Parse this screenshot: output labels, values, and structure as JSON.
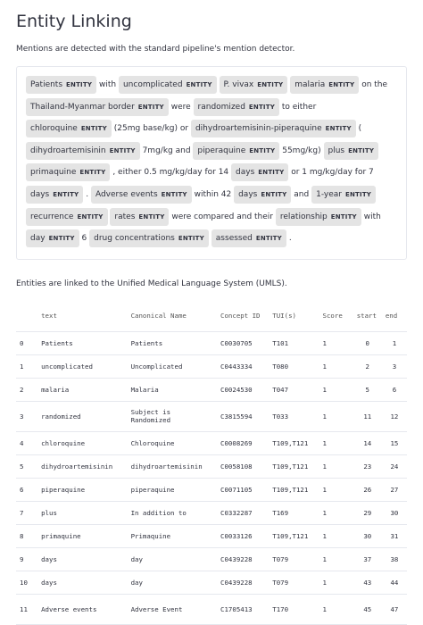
{
  "page": {
    "title": "Entity Linking",
    "ner_caption": "Mentions are detected with the standard pipeline's mention detector.",
    "table_caption": "Entities are linked to the Unified Medical Language System (UMLS)."
  },
  "ner": {
    "label": "ENTITY",
    "tokens": [
      {
        "t": "Patients",
        "e": true
      },
      {
        "t": "with",
        "e": false
      },
      {
        "t": "uncomplicated",
        "e": true
      },
      {
        "t": "P. vivax",
        "e": true
      },
      {
        "t": "malaria",
        "e": true
      },
      {
        "t": "on the",
        "e": false
      },
      {
        "t": "Thailand-Myanmar border",
        "e": true
      },
      {
        "t": "were",
        "e": false
      },
      {
        "t": "randomized",
        "e": true
      },
      {
        "t": "to either",
        "e": false
      },
      {
        "t": "chloroquine",
        "e": true
      },
      {
        "t": "(25mg base/kg) or",
        "e": false
      },
      {
        "t": "dihydroartemisinin-piperaquine",
        "e": true
      },
      {
        "t": "(",
        "e": false
      },
      {
        "t": "dihydroartemisinin",
        "e": true
      },
      {
        "t": "7mg/kg and",
        "e": false
      },
      {
        "t": "piperaquine",
        "e": true
      },
      {
        "t": "55mg/kg)",
        "e": false
      },
      {
        "t": "plus",
        "e": true
      },
      {
        "t": "primaquine",
        "e": true
      },
      {
        "t": ", either 0.5 mg/kg/day for 14",
        "e": false
      },
      {
        "t": "days",
        "e": true
      },
      {
        "t": "or 1 mg/kg/day for 7",
        "e": false
      },
      {
        "t": "days",
        "e": true
      },
      {
        "t": ".",
        "e": false
      },
      {
        "t": "Adverse events",
        "e": true
      },
      {
        "t": "within 42",
        "e": false
      },
      {
        "t": "days",
        "e": true
      },
      {
        "t": "and",
        "e": false
      },
      {
        "t": "1-year",
        "e": true
      },
      {
        "t": "recurrence",
        "e": true
      },
      {
        "t": "rates",
        "e": true
      },
      {
        "t": "were compared and their",
        "e": false
      },
      {
        "t": "relationship",
        "e": true
      },
      {
        "t": "with",
        "e": false
      },
      {
        "t": "day",
        "e": true
      },
      {
        "t": "6",
        "e": false
      },
      {
        "t": "drug concentrations",
        "e": true
      },
      {
        "t": "assessed",
        "e": true
      },
      {
        "t": ".",
        "e": false
      }
    ]
  },
  "table": {
    "headers": [
      "",
      "text",
      "Canonical Name",
      "Concept ID",
      "TUI(s)",
      "Score",
      "start",
      "end"
    ],
    "rows": [
      [
        "0",
        "Patients",
        "Patients",
        "C0030705",
        "T101",
        "1",
        "0",
        "1"
      ],
      [
        "1",
        "uncomplicated",
        "Uncomplicated",
        "C0443334",
        "T080",
        "1",
        "2",
        "3"
      ],
      [
        "2",
        "malaria",
        "Malaria",
        "C0024530",
        "T047",
        "1",
        "5",
        "6"
      ],
      [
        "3",
        "randomized",
        "Subject is Randomized",
        "C3815594",
        "T033",
        "1",
        "11",
        "12"
      ],
      [
        "4",
        "chloroquine",
        "Chloroquine",
        "C0008269",
        "T109,T121",
        "1",
        "14",
        "15"
      ],
      [
        "5",
        "dihydroartemisinin",
        "dihydroartemisinin",
        "C0058108",
        "T109,T121",
        "1",
        "23",
        "24"
      ],
      [
        "6",
        "piperaquine",
        "piperaquine",
        "C0071105",
        "T109,T121",
        "1",
        "26",
        "27"
      ],
      [
        "7",
        "plus",
        "In addition to",
        "C0332287",
        "T169",
        "1",
        "29",
        "30"
      ],
      [
        "8",
        "primaquine",
        "Primaquine",
        "C0033126",
        "T109,T121",
        "1",
        "30",
        "31"
      ],
      [
        "9",
        "days",
        "day",
        "C0439228",
        "T079",
        "1",
        "37",
        "38"
      ],
      [
        "10",
        "days",
        "day",
        "C0439228",
        "T079",
        "1",
        "43",
        "44"
      ],
      [
        "11",
        "Adverse events",
        "Adverse Event",
        "C1705413",
        "T170",
        "1",
        "45",
        "47"
      ]
    ]
  }
}
